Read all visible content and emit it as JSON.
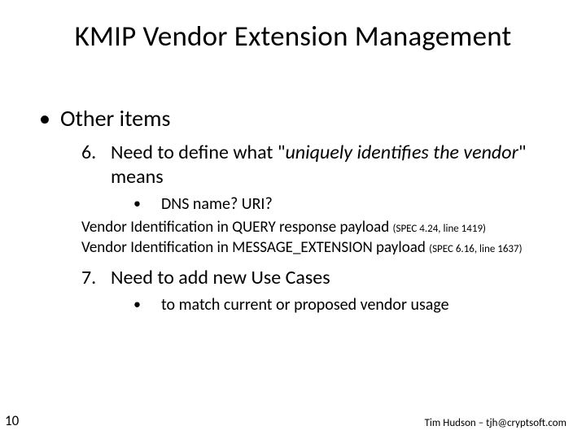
{
  "title": "KMIP Vendor Extension Management",
  "l1": "Other items",
  "item6": {
    "num": "6.",
    "text_a": "Need to define what \"",
    "text_italic": "uniquely identifies the vendor",
    "text_b": "\" means",
    "sub": "DNS name? URI?",
    "note1_a": "Vendor Identification in QUERY response payload ",
    "note1_spec": "(SPEC 4.24, line 1419)",
    "note2_a": "Vendor Identification in MESSAGE_EXTENSION payload ",
    "note2_spec": "(SPEC 6.16, line 1637)"
  },
  "item7": {
    "num": "7.",
    "text": "Need to add new Use Cases",
    "sub": "to match current or proposed vendor usage"
  },
  "page": "10",
  "footer": "Tim Hudson – tjh@cryptsoft.com"
}
